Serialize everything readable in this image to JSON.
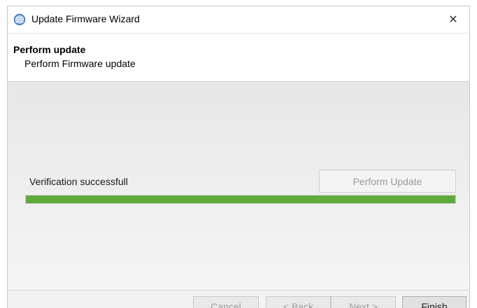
{
  "window": {
    "title": "Update Firmware Wizard",
    "icon": "app-globe-icon",
    "close_icon": "close-icon",
    "close_glyph": "✕"
  },
  "header": {
    "title": "Perform update",
    "subtitle": "Perform Firmware update"
  },
  "content": {
    "status": "Verification successfull",
    "perform_button": "Perform Update",
    "progress_percent": 100,
    "progress_color": "#5dab3a"
  },
  "footer": {
    "cancel": "Cancel",
    "back": "< Back",
    "next": "Next >",
    "finish": "Finish"
  }
}
